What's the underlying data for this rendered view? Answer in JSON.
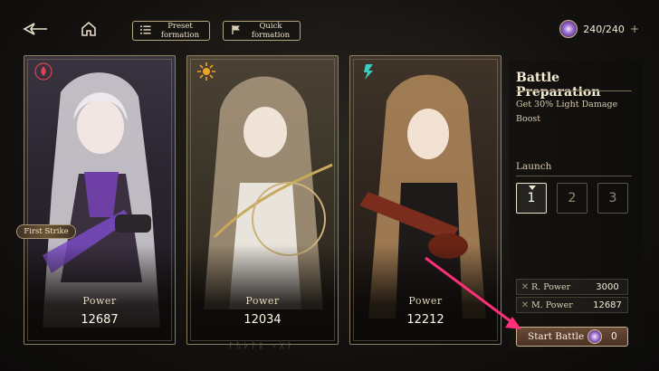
{
  "topbar": {
    "back_icon": "back-arrow-icon",
    "home_icon": "home-icon",
    "preset_formation": "Preset\nformation",
    "quick_formation": "Quick\nformation",
    "stamina": "240/240",
    "stamina_plus": "+"
  },
  "cards": [
    {
      "element_icon": "fire-element-icon",
      "element_color": "#e0414f",
      "power_label": "Power",
      "power": "12687",
      "badge": "First Strike"
    },
    {
      "element_icon": "light-element-icon",
      "element_color": "#f0a329",
      "power_label": "Power",
      "power": "12034"
    },
    {
      "element_icon": "wind-element-icon",
      "element_color": "#35d0c4",
      "power_label": "Power",
      "power": "12212"
    }
  ],
  "panel": {
    "title": "Battle Preparation",
    "description": "Get 30% Light Damage Boost",
    "launch_label": "Launch",
    "launch_slots": [
      "1",
      "2",
      "3"
    ],
    "selected_slot": "1",
    "r_power_label": "R. Power",
    "r_power": "3000",
    "m_power_label": "M. Power",
    "m_power": "12687"
  },
  "start_battle": {
    "label": "Start Battle",
    "cost": "0"
  },
  "colors": {
    "accent_gold": "#c8b287",
    "annotation_arrow": "#ff2f7a"
  }
}
